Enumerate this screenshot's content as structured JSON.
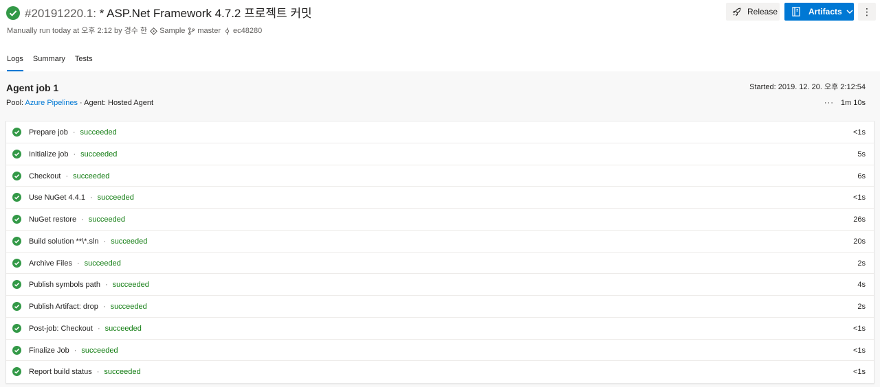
{
  "header": {
    "run_id": "#20191220.1:",
    "title": " * ASP.Net Framework 4.7.2 프로젝트 커밋",
    "subtitle": {
      "run_text": "Manually run today at 오후 2:12 by 경수 한",
      "repo": "Sample",
      "branch": "master",
      "commit": "ec48280"
    },
    "release_label": "Release",
    "artifacts_label": "Artifacts",
    "more_label": "⋮"
  },
  "tabs": [
    {
      "label": "Logs"
    },
    {
      "label": "Summary"
    },
    {
      "label": "Tests"
    }
  ],
  "job": {
    "title": "Agent job 1",
    "pool_prefix": "Pool: ",
    "pool_link": "Azure Pipelines",
    "agent": " · Agent: Hosted Agent",
    "started": "Started: 2019. 12. 20. 오후 2:12:54",
    "duration_dots": "···",
    "duration": "1m 10s"
  },
  "steps": [
    {
      "name": "Prepare job",
      "status": "succeeded",
      "duration": "<1s"
    },
    {
      "name": "Initialize job",
      "status": "succeeded",
      "duration": "5s"
    },
    {
      "name": "Checkout",
      "status": "succeeded",
      "duration": "6s"
    },
    {
      "name": "Use NuGet 4.4.1",
      "status": "succeeded",
      "duration": "<1s"
    },
    {
      "name": "NuGet restore",
      "status": "succeeded",
      "duration": "26s"
    },
    {
      "name": "Build solution **\\*.sln",
      "status": "succeeded",
      "duration": "20s"
    },
    {
      "name": "Archive Files",
      "status": "succeeded",
      "duration": "2s"
    },
    {
      "name": "Publish symbols path",
      "status": "succeeded",
      "duration": "4s"
    },
    {
      "name": "Publish Artifact: drop",
      "status": "succeeded",
      "duration": "2s"
    },
    {
      "name": "Post-job: Checkout",
      "status": "succeeded",
      "duration": "<1s"
    },
    {
      "name": "Finalize Job",
      "status": "succeeded",
      "duration": "<1s"
    },
    {
      "name": "Report build status",
      "status": "succeeded",
      "duration": "<1s"
    }
  ],
  "colors": {
    "success": "#107c10",
    "accent": "#0078d4"
  },
  "icons": {
    "status": "check-circle-icon",
    "release": "rocket-icon",
    "artifacts": "artifact-icon",
    "repo": "repo-icon",
    "branch": "branch-icon",
    "commit": "commit-icon"
  }
}
